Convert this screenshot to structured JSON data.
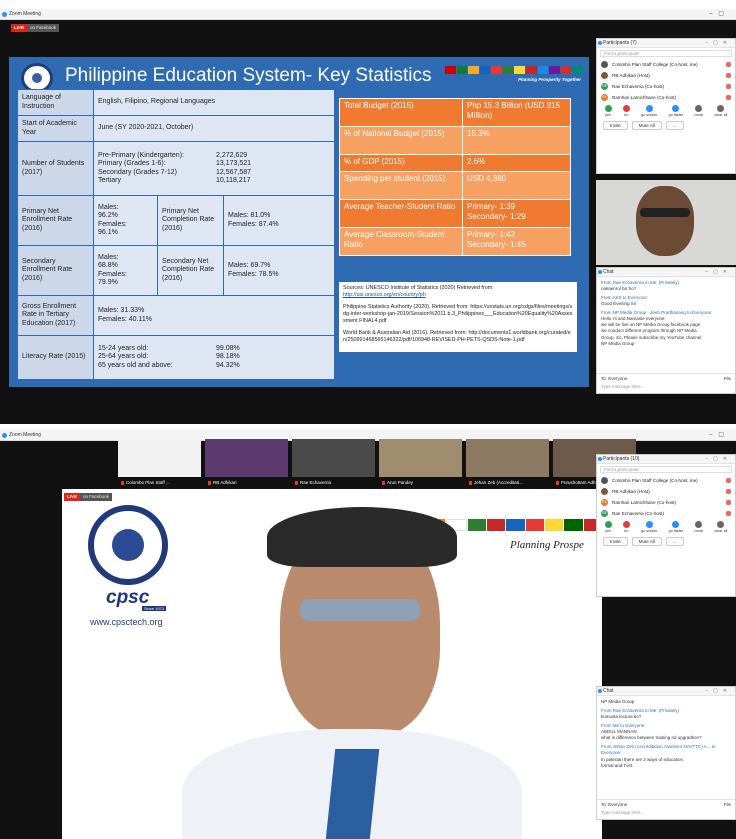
{
  "top_window": {
    "title": "Zoom Meeting",
    "live": "LIVE",
    "live_on": "on Facebook"
  },
  "bottom_window": {
    "title": "Zoom Meeting",
    "live": "LIVE",
    "live_on": "on Facebook"
  },
  "slide": {
    "title": "Philippine Education System- Key Statistics",
    "tagline": "Planning Prosperity Together",
    "left_table": {
      "r1k": "Language of Instruction",
      "r1v": "English, Filipino, Regional Languages",
      "r2k": "Start of Academic Year",
      "r2v": "June (SY 2020-2021, October)",
      "r3k": "Number of Students (2017)",
      "r3a": "Pre-Primary (Kindergarten):",
      "r3a_v": "2,272,629",
      "r3b": "Primary (Grades 1-6):",
      "r3b_v": "13,173,521",
      "r3c": "Secondary (Grades 7-12)",
      "r3c_v": "12,567,587",
      "r3d": "Tertiary",
      "r3d_v": "10,118,217",
      "r4k": "Primary Net Enrollment Rate (2016)",
      "r4v": "Males:\n96.2%\nFemales:\n96.1%",
      "r4k2": "Primary Net Completion Rate (2016)",
      "r4v2": "Males: 81.0%\nFemales: 87.4%",
      "r5k": "Secondary Enrollment Rate (2016)",
      "r5v": "Males:\n68.8%\nFemales:\n79.9%",
      "r5k2": "Secondary Net Completion Rate (2016)",
      "r5v2": "Males: 69.7%\nFemales: 78.5%",
      "r6k": "Gross Enrollment Rate in Tertiary Education (2017)",
      "r6v": "Males: 31.33%\nFemales: 40.11%",
      "r7k": "Literacy Rate (2015)",
      "r7a": "15-24 years old:",
      "r7a_v": "99.08%",
      "r7b": "25-64 years old:",
      "r7b_v": "98.18%",
      "r7c": "65 years old and above:",
      "r7c_v": "94.32%"
    },
    "right_table": [
      {
        "k": "Total Budget (2015)",
        "v": "Php 15.3 Billion (USD 315 Million)"
      },
      {
        "k": "% of National Budget (2015)",
        "v": "15.3%"
      },
      {
        "k": "% of GDP (2015)",
        "v": "2.6%"
      },
      {
        "k": "Spending per student (2015)",
        "v": "USD 4,380"
      },
      {
        "k": "Average Teacher-Student Ratio",
        "v": "Primary- 1:39\nSecondary- 1:29"
      },
      {
        "k": "Average Classroom-Student Ratio",
        "v": "Primary- 1:42\nSecondary- 1:45"
      }
    ],
    "sources": {
      "s1": "Sources: UNESCO Institute of Statistics (2020) Retrieved from:",
      "s1_link": "http://uis.unesco.org/en/country/ph",
      "s2": "Philippine Statistics Authority (2020). Retrieved from: https://unstats.un.org/sdgs/files/meetings/sdg-inter-workshop-jan-2019/Session%2011.b.3_Philippines___Education%20Equality%20Assessment FINAL4.pdf",
      "s3": "World Bank & Australian Aid (2016). Retrieved from: http://documents1.worldbank.org/curated/en/250991468565146322/pdf/106948-REVISED-PH-PETS-QSDS-Note-1.pdf"
    }
  },
  "participants_top": {
    "title": "Participants (7)",
    "search": "Find a participant",
    "people": [
      {
        "name": "Colombo Plan Staff College (Co-host, me)",
        "initials": "",
        "color": "#555"
      },
      {
        "name": "RB Adhikari (Host)",
        "initials": "",
        "color": "#7a5c3a"
      },
      {
        "name": "Rae Echaverria (Co-host)",
        "initials": "RE",
        "color": "#2e9e5b"
      },
      {
        "name": "Ramhari Lamichhane (Co-host)",
        "initials": "RL",
        "color": "#e37b2b"
      }
    ],
    "controls": [
      "yes",
      "no",
      "go slower",
      "go faster",
      "more",
      "clear all"
    ],
    "btn_invite": "Invite",
    "btn_mute": "Mute All",
    "btn_more": "..."
  },
  "chat_top": {
    "title": "Chat",
    "messages": [
      {
        "from": "From Rae Echaverria to Me: (Privately)",
        "text": "nakaenrol ba 'ko?"
      },
      {
        "from": "From AKS to Everyone:",
        "text": "Good Evening Sir"
      },
      {
        "from": "From NP Media Group - Jeeb Pradhanang to Everyone:",
        "text": "Hello Hi and Namaste everyone\nwe will be live on NP Media Group facebook page\nwe conduct different program through NP Media\nGroup. So, Please subscribe my YouTube channel\nNP Media Group"
      }
    ],
    "to": "To: Everyone",
    "file": "File",
    "placeholder": "Type message here..."
  },
  "thumbs": [
    {
      "name": "Colombo Plan Staff ..."
    },
    {
      "name": "RB Adhikari"
    },
    {
      "name": "Rae Echaverria"
    },
    {
      "name": "Arun Pandey"
    },
    {
      "name": "Jehan Zeb (Accreditati..."
    },
    {
      "name": "Purushottam Adh..."
    }
  ],
  "bottom_slide": {
    "website": "www.cpsctech.org",
    "cpsc": "cpsc",
    "since": "Since 1973",
    "tagline": "Planning Prospe"
  },
  "participants_bottom": {
    "title": "Participants (10)",
    "search": "Find a participant",
    "people": [
      {
        "name": "Colombo Plan Staff College (Co-host, me)",
        "initials": "",
        "color": "#555"
      },
      {
        "name": "RB Adhikari (Host)",
        "initials": "",
        "color": "#7a5c3a"
      },
      {
        "name": "Ramhari Lamichhane (Co-host)",
        "initials": "RL",
        "color": "#e37b2b"
      },
      {
        "name": "Rae Echaverria (Co-host)",
        "initials": "RE",
        "color": "#2e9e5b"
      }
    ],
    "controls": [
      "yes",
      "no",
      "go slower",
      "go faster",
      "more",
      "clear all"
    ],
    "btn_invite": "Invite",
    "btn_mute": "Mute All",
    "btn_more": "..."
  },
  "chat_bottom": {
    "title": "Chat",
    "sub": "NP Media Group",
    "messages": [
      {
        "from": "From Rae Echaverria to Me: (Privately)",
        "text": "kumusta lecture ko?"
      },
      {
        "from": "From Me to Everyone:",
        "text": "ABDUL MANNAN\nwhat is difference between training nd upgradtion?"
      },
      {
        "from": "From Jehan Zeb (Accreditation Assessor NAVTTC) A... to Everyone:",
        "text": "In pakistan there are 2 ways of education\nformal and Tvet."
      }
    ],
    "to": "To: Everyone",
    "file": "File",
    "placeholder": "Type message here..."
  }
}
